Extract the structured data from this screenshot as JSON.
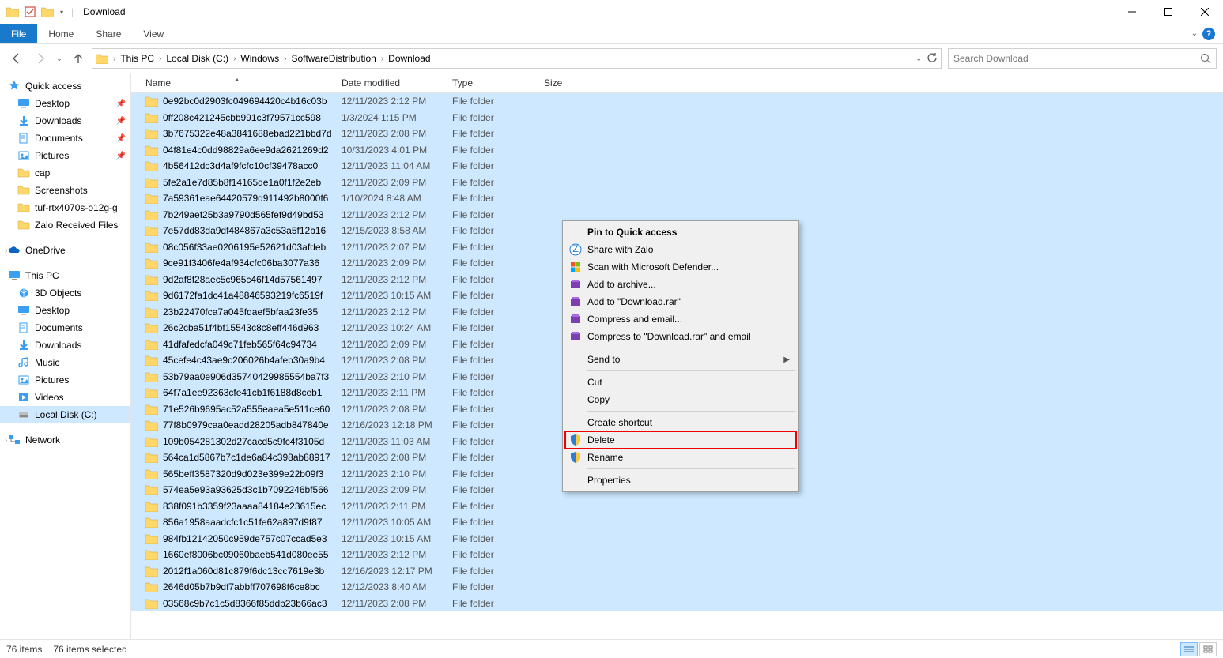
{
  "window": {
    "title": "Download"
  },
  "ribbon": {
    "file": "File",
    "tabs": [
      "Home",
      "Share",
      "View"
    ]
  },
  "breadcrumb": [
    "This PC",
    "Local Disk (C:)",
    "Windows",
    "SoftwareDistribution",
    "Download"
  ],
  "search": {
    "placeholder": "Search Download"
  },
  "columns": {
    "name": "Name",
    "date": "Date modified",
    "type": "Type",
    "size": "Size"
  },
  "sidebar": {
    "quick_access": {
      "label": "Quick access",
      "items": [
        {
          "label": "Desktop",
          "pinned": true,
          "icon": "desktop"
        },
        {
          "label": "Downloads",
          "pinned": true,
          "icon": "downloads"
        },
        {
          "label": "Documents",
          "pinned": true,
          "icon": "documents"
        },
        {
          "label": "Pictures",
          "pinned": true,
          "icon": "pictures"
        },
        {
          "label": "cap",
          "pinned": false,
          "icon": "folder"
        },
        {
          "label": "Screenshots",
          "pinned": false,
          "icon": "folder"
        },
        {
          "label": "tuf-rtx4070s-o12g-g",
          "pinned": false,
          "icon": "folder"
        },
        {
          "label": "Zalo Received Files",
          "pinned": false,
          "icon": "folder"
        }
      ]
    },
    "onedrive": {
      "label": "OneDrive"
    },
    "this_pc": {
      "label": "This PC",
      "items": [
        {
          "label": "3D Objects",
          "icon": "3d"
        },
        {
          "label": "Desktop",
          "icon": "desktop"
        },
        {
          "label": "Documents",
          "icon": "documents"
        },
        {
          "label": "Downloads",
          "icon": "downloads"
        },
        {
          "label": "Music",
          "icon": "music"
        },
        {
          "label": "Pictures",
          "icon": "pictures"
        },
        {
          "label": "Videos",
          "icon": "videos"
        },
        {
          "label": "Local Disk (C:)",
          "icon": "disk",
          "selected": true
        }
      ]
    },
    "network": {
      "label": "Network"
    }
  },
  "files": [
    {
      "name": "0e92bc0d2903fc049694420c4b16c03b",
      "date": "12/11/2023 2:12 PM",
      "type": "File folder"
    },
    {
      "name": "0ff208c421245cbb991c3f79571cc598",
      "date": "1/3/2024 1:15 PM",
      "type": "File folder"
    },
    {
      "name": "3b7675322e48a3841688ebad221bbd7d",
      "date": "12/11/2023 2:08 PM",
      "type": "File folder"
    },
    {
      "name": "04f81e4c0dd98829a6ee9da2621269d2",
      "date": "10/31/2023 4:01 PM",
      "type": "File folder"
    },
    {
      "name": "4b56412dc3d4af9fcfc10cf39478acc0",
      "date": "12/11/2023 11:04 AM",
      "type": "File folder"
    },
    {
      "name": "5fe2a1e7d85b8f14165de1a0f1f2e2eb",
      "date": "12/11/2023 2:09 PM",
      "type": "File folder"
    },
    {
      "name": "7a59361eae64420579d911492b8000f6",
      "date": "1/10/2024 8:48 AM",
      "type": "File folder"
    },
    {
      "name": "7b249aef25b3a9790d565fef9d49bd53",
      "date": "12/11/2023 2:12 PM",
      "type": "File folder"
    },
    {
      "name": "7e57dd83da9df484867a3c53a5f12b16",
      "date": "12/15/2023 8:58 AM",
      "type": "File folder"
    },
    {
      "name": "08c056f33ae0206195e52621d03afdeb",
      "date": "12/11/2023 2:07 PM",
      "type": "File folder"
    },
    {
      "name": "9ce91f3406fe4af934cfc06ba3077a36",
      "date": "12/11/2023 2:09 PM",
      "type": "File folder"
    },
    {
      "name": "9d2af8f28aec5c965c46f14d57561497",
      "date": "12/11/2023 2:12 PM",
      "type": "File folder"
    },
    {
      "name": "9d6172fa1dc41a48846593219fc6519f",
      "date": "12/11/2023 10:15 AM",
      "type": "File folder"
    },
    {
      "name": "23b22470fca7a045fdaef5bfaa23fe35",
      "date": "12/11/2023 2:12 PM",
      "type": "File folder"
    },
    {
      "name": "26c2cba51f4bf15543c8c8eff446d963",
      "date": "12/11/2023 10:24 AM",
      "type": "File folder"
    },
    {
      "name": "41dfafedcfa049c71feb565f64c94734",
      "date": "12/11/2023 2:09 PM",
      "type": "File folder"
    },
    {
      "name": "45cefe4c43ae9c206026b4afeb30a9b4",
      "date": "12/11/2023 2:08 PM",
      "type": "File folder"
    },
    {
      "name": "53b79aa0e906d35740429985554ba7f3",
      "date": "12/11/2023 2:10 PM",
      "type": "File folder"
    },
    {
      "name": "64f7a1ee92363cfe41cb1f6188d8ceb1",
      "date": "12/11/2023 2:11 PM",
      "type": "File folder"
    },
    {
      "name": "71e526b9695ac52a555eaea5e511ce60",
      "date": "12/11/2023 2:08 PM",
      "type": "File folder"
    },
    {
      "name": "77f8b0979caa0eadd28205adb847840e",
      "date": "12/16/2023 12:18 PM",
      "type": "File folder"
    },
    {
      "name": "109b054281302d27cacd5c9fc4f3105d",
      "date": "12/11/2023 11:03 AM",
      "type": "File folder"
    },
    {
      "name": "564ca1d5867b7c1de6a84c398ab88917",
      "date": "12/11/2023 2:08 PM",
      "type": "File folder"
    },
    {
      "name": "565beff3587320d9d023e399e22b09f3",
      "date": "12/11/2023 2:10 PM",
      "type": "File folder"
    },
    {
      "name": "574ea5e93a93625d3c1b7092246bf566",
      "date": "12/11/2023 2:09 PM",
      "type": "File folder"
    },
    {
      "name": "838f091b3359f23aaaa84184e23615ec",
      "date": "12/11/2023 2:11 PM",
      "type": "File folder"
    },
    {
      "name": "856a1958aaadcfc1c51fe62a897d9f87",
      "date": "12/11/2023 10:05 AM",
      "type": "File folder"
    },
    {
      "name": "984fb12142050c959de757c07ccad5e3",
      "date": "12/11/2023 10:15 AM",
      "type": "File folder"
    },
    {
      "name": "1660ef8006bc09060baeb541d080ee55",
      "date": "12/11/2023 2:12 PM",
      "type": "File folder"
    },
    {
      "name": "2012f1a060d81c879f6dc13cc7619e3b",
      "date": "12/16/2023 12:17 PM",
      "type": "File folder"
    },
    {
      "name": "2646d05b7b9df7abbff707698f6ce8bc",
      "date": "12/12/2023 8:40 AM",
      "type": "File folder"
    },
    {
      "name": "03568c9b7c1c5d8366f85ddb23b66ac3",
      "date": "12/11/2023 2:08 PM",
      "type": "File folder"
    }
  ],
  "context_menu": {
    "pin": "Pin to Quick access",
    "zalo": "Share with Zalo",
    "defender": "Scan with Microsoft Defender...",
    "archive": "Add to archive...",
    "add_rar": "Add to \"Download.rar\"",
    "compress_email": "Compress and email...",
    "compress_rar_email": "Compress to \"Download.rar\" and email",
    "send_to": "Send to",
    "cut": "Cut",
    "copy": "Copy",
    "shortcut": "Create shortcut",
    "delete": "Delete",
    "rename": "Rename",
    "properties": "Properties"
  },
  "status": {
    "items": "76 items",
    "selected": "76 items selected"
  }
}
